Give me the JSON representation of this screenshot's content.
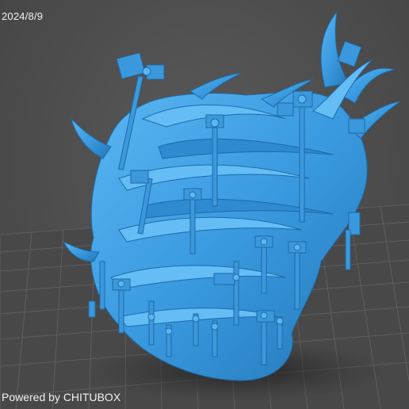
{
  "viewport": {
    "date_stamp": "2024/8/9",
    "watermark": "Powered by CHITUBOX",
    "model_color": "#3fa1e6",
    "grid_color": "#5d5d5d",
    "background_color": "#4f4f4f"
  }
}
